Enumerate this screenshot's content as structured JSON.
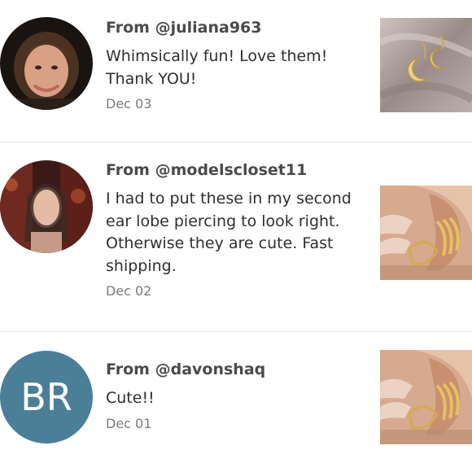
{
  "reviews": [
    {
      "from": "From @juliana963",
      "text": "Whimsically fun! Love them! Thank YOU!",
      "date": "Dec 03",
      "avatar": "user-photo",
      "product_image": "crescent-moon-earrings"
    },
    {
      "from": "From @modelscloset11",
      "text": "I had to put these in my second ear lobe piercing to look right. Otherwise they are cute. Fast shipping.",
      "date": "Dec 02",
      "avatar": "user-photo",
      "product_image": "gold-claw-ear-cuff"
    },
    {
      "from": "From @davonshaq",
      "text": "Cute!!",
      "date": "Dec 01",
      "avatar_initials": "BR",
      "avatar_color": "#4b7f98",
      "product_image": "gold-claw-ear-cuff"
    }
  ]
}
